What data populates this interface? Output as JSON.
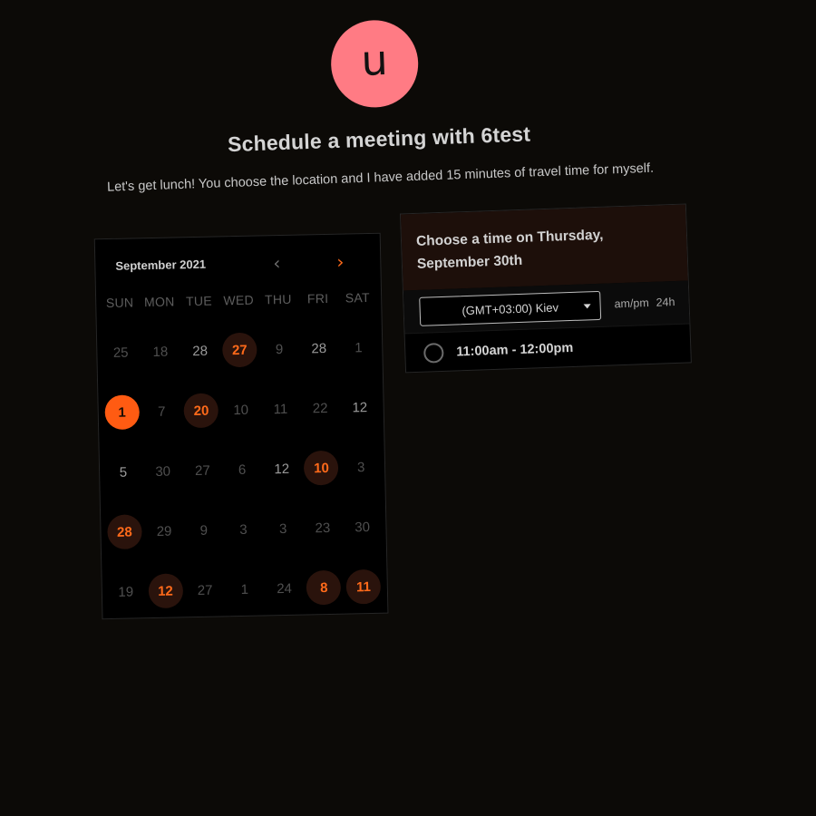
{
  "profile": {
    "avatar_letter": "u",
    "avatar_color": "#ff7b84"
  },
  "page": {
    "title": "Schedule a meeting with 6test",
    "subtitle": "Let's get lunch! You choose the location and I have added 15 minutes of travel time for myself."
  },
  "calendar": {
    "month": "September 2021",
    "prev_icon": "chevron-left-icon",
    "next_icon": "chevron-right-icon",
    "accent_color": "#ff6a1a",
    "weekdays": [
      "SUN",
      "MON",
      "TUE",
      "WED",
      "THU",
      "FRI",
      "SAT"
    ],
    "days": [
      {
        "label": "25",
        "state": "disabled"
      },
      {
        "label": "18",
        "state": "disabled"
      },
      {
        "label": "28",
        "state": "light"
      },
      {
        "label": "27",
        "state": "available"
      },
      {
        "label": "9",
        "state": "disabled"
      },
      {
        "label": "28",
        "state": "light"
      },
      {
        "label": "1",
        "state": "disabled"
      },
      {
        "label": "1",
        "state": "selected"
      },
      {
        "label": "7",
        "state": "disabled"
      },
      {
        "label": "20",
        "state": "available"
      },
      {
        "label": "10",
        "state": "disabled"
      },
      {
        "label": "11",
        "state": "disabled"
      },
      {
        "label": "22",
        "state": "disabled"
      },
      {
        "label": "12",
        "state": "light"
      },
      {
        "label": "5",
        "state": "light"
      },
      {
        "label": "30",
        "state": "disabled"
      },
      {
        "label": "27",
        "state": "disabled"
      },
      {
        "label": "6",
        "state": "disabled"
      },
      {
        "label": "12",
        "state": "light"
      },
      {
        "label": "10",
        "state": "available"
      },
      {
        "label": "3",
        "state": "disabled"
      },
      {
        "label": "28",
        "state": "available"
      },
      {
        "label": "29",
        "state": "disabled"
      },
      {
        "label": "9",
        "state": "disabled"
      },
      {
        "label": "3",
        "state": "disabled"
      },
      {
        "label": "3",
        "state": "disabled"
      },
      {
        "label": "23",
        "state": "disabled"
      },
      {
        "label": "30",
        "state": "disabled"
      },
      {
        "label": "19",
        "state": "disabled"
      },
      {
        "label": "12",
        "state": "available"
      },
      {
        "label": "27",
        "state": "disabled"
      },
      {
        "label": "1",
        "state": "disabled"
      },
      {
        "label": "24",
        "state": "disabled"
      },
      {
        "label": "8",
        "state": "available"
      },
      {
        "label": "11",
        "state": "available"
      }
    ]
  },
  "time_panel": {
    "heading": "Choose a time on Thursday, September 30th",
    "timezone": "(GMT+03:00) Kiev",
    "format_ampm": "am/pm",
    "format_24h": "24h",
    "slots": [
      {
        "label": "11:00am - 12:00pm"
      }
    ]
  }
}
